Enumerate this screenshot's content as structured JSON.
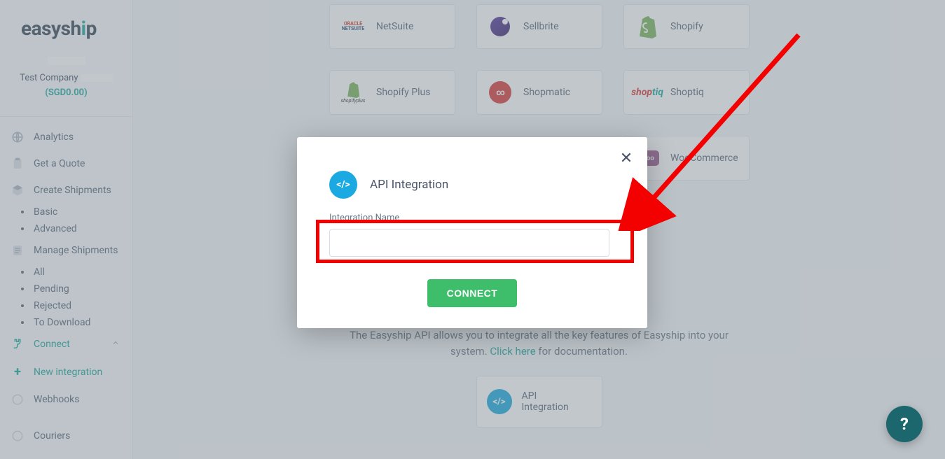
{
  "brand": {
    "name_part1": "easysh",
    "name_part2": "i",
    "name_part3": "p"
  },
  "company": {
    "name": "Test Company",
    "balance": "(SGD0.00)"
  },
  "nav": {
    "analytics": "Analytics",
    "get_quote": "Get a Quote",
    "create_shipments": "Create Shipments",
    "basic": "Basic",
    "advanced": "Advanced",
    "manage_shipments": "Manage Shipments",
    "all": "All",
    "pending": "Pending",
    "rejected": "Rejected",
    "to_download": "To Download",
    "connect": "Connect",
    "new_integration": "New integration",
    "webhooks": "Webhooks",
    "couriers": "Couriers"
  },
  "integrations": {
    "netsuite": "NetSuite",
    "sellbrite": "Sellbrite",
    "shopify": "Shopify",
    "shopify_plus": "Shopify Plus",
    "shopmatic": "Shopmatic",
    "shoptiq": "Shoptiq",
    "woocommerce": "WooCommerce"
  },
  "api_section": {
    "description_1": "The Easyship API allows you to integrate all the key features of Easyship into your",
    "description_2a": "system. ",
    "link_text": "Click here",
    "description_2b": " for documentation.",
    "card_line1": "API",
    "card_line2": "Integration"
  },
  "modal": {
    "title": "API Integration",
    "field_label": "Integration Name",
    "input_value": "",
    "input_placeholder": "",
    "connect_button": "CONNECT"
  },
  "help": {
    "label": "?"
  }
}
